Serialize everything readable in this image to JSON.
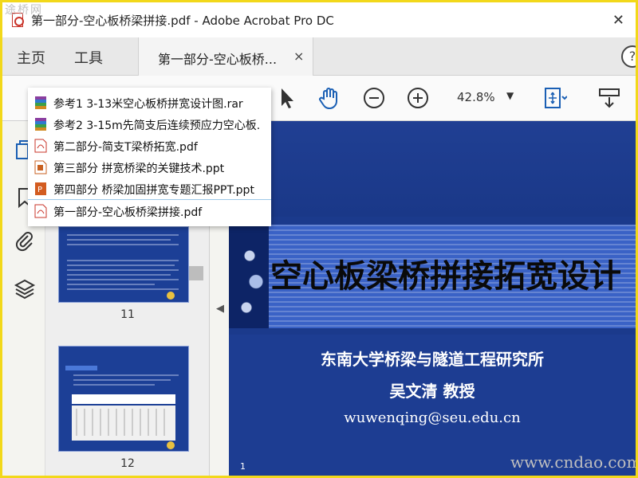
{
  "window": {
    "title": "第一部分-空心板桥梁拼接.pdf - Adobe Acrobat Pro DC",
    "close_glyph": "✕"
  },
  "menu": {
    "home": "主页",
    "tools": "工具"
  },
  "tab": {
    "label": "第一部分-空心板桥...",
    "close_glyph": "×"
  },
  "help_glyph": "?",
  "toolbar": {
    "zoom_value": "42.8%",
    "zoom_caret": "▼"
  },
  "popup": {
    "items": [
      {
        "label": "参考1 3-13米空心板桥拼宽设计图.rar",
        "icon": "rar-archive-icon"
      },
      {
        "label": "参考2 3-15m先简支后连续预应力空心板.",
        "icon": "rar-archive-icon"
      },
      {
        "label": "第二部分-简支T梁桥拓宽.pdf",
        "icon": "pdf-file-icon"
      },
      {
        "label": "第三部分 拼宽桥梁的关键技术.ppt",
        "icon": "ppt-file-icon"
      },
      {
        "label": "第四部分 桥梁加固拼宽专题汇报PPT.ppt",
        "icon": "ppt-file-icon"
      },
      {
        "label": "第一部分-空心板桥梁拼接.pdf",
        "icon": "pdf-file-icon"
      }
    ]
  },
  "thumbnails": {
    "page_a": "11",
    "page_b": "12"
  },
  "slide": {
    "title": "空心板梁桥拼接拓宽设计",
    "institution": "东南大学桥梁与隧道工程研究所",
    "author": "吴文清  教授",
    "email": "wuwenqing@seu.edu.cn",
    "page_number": "1"
  },
  "watermarks": {
    "top": "途桥网",
    "bottom": "www.cndao.com"
  },
  "colors": {
    "frame": "#f2d81a",
    "slide_blue": "#1b3a8c",
    "pdf_red": "#c9342a"
  }
}
